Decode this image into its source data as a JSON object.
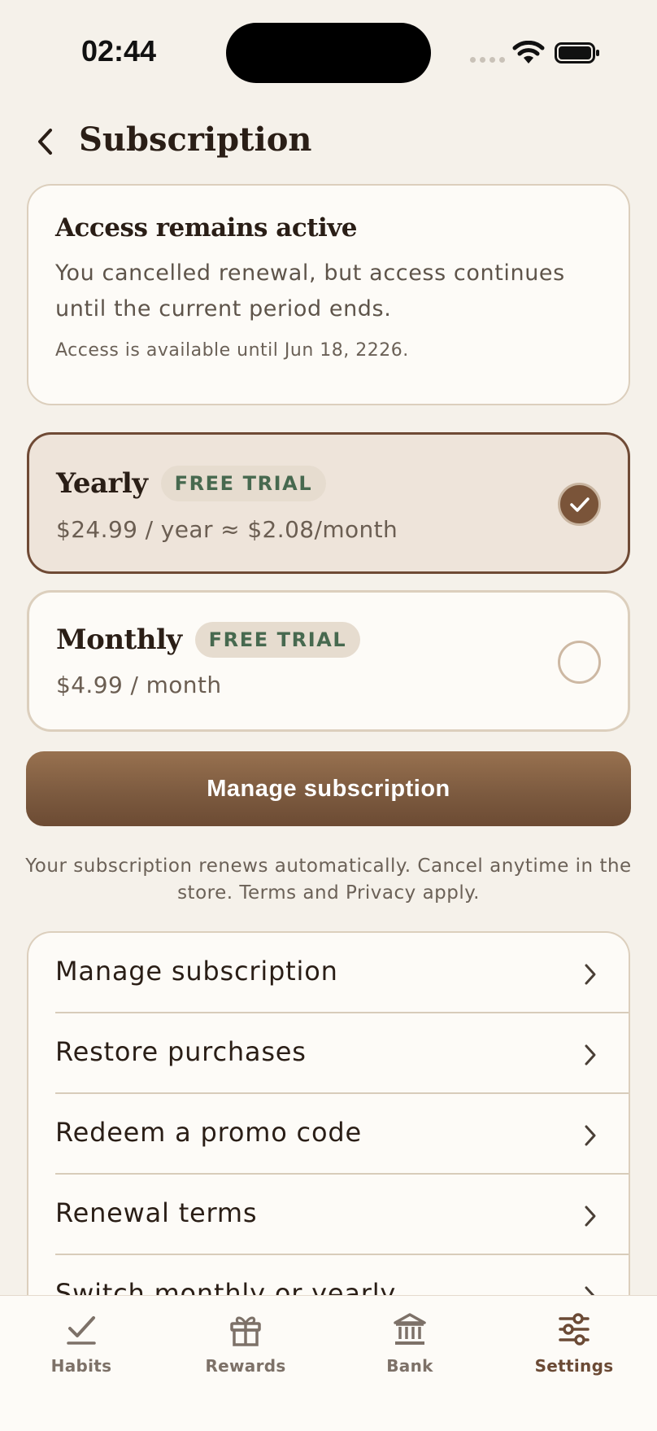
{
  "status": {
    "time": "02:44"
  },
  "header": {
    "title": "Subscription"
  },
  "notice": {
    "title": "Access remains active",
    "body": "You cancelled renewal, but access continues until the current period ends.",
    "note": "Access is available until Jun 18, 2226."
  },
  "plans": [
    {
      "name": "Yearly",
      "badge": "FREE TRIAL",
      "price": "$24.99 / year ≈ $2.08/month",
      "selected": true
    },
    {
      "name": "Monthly",
      "badge": "FREE TRIAL",
      "price": "$4.99 / month",
      "selected": false
    }
  ],
  "primary_button": "Manage subscription",
  "legal": "Your subscription renews automatically. Cancel anytime in the store. Terms and Privacy apply.",
  "options": [
    "Manage subscription",
    "Restore purchases",
    "Redeem a promo code",
    "Renewal terms",
    "Switch monthly or yearly"
  ],
  "tabs": [
    {
      "label": "Habits",
      "icon": "check-icon"
    },
    {
      "label": "Rewards",
      "icon": "gift-icon"
    },
    {
      "label": "Bank",
      "icon": "bank-icon"
    },
    {
      "label": "Settings",
      "icon": "sliders-icon",
      "active": true
    }
  ],
  "colors": {
    "background": "#f5f1ea",
    "accent": "#7a5439",
    "badge_text": "#47694f"
  }
}
